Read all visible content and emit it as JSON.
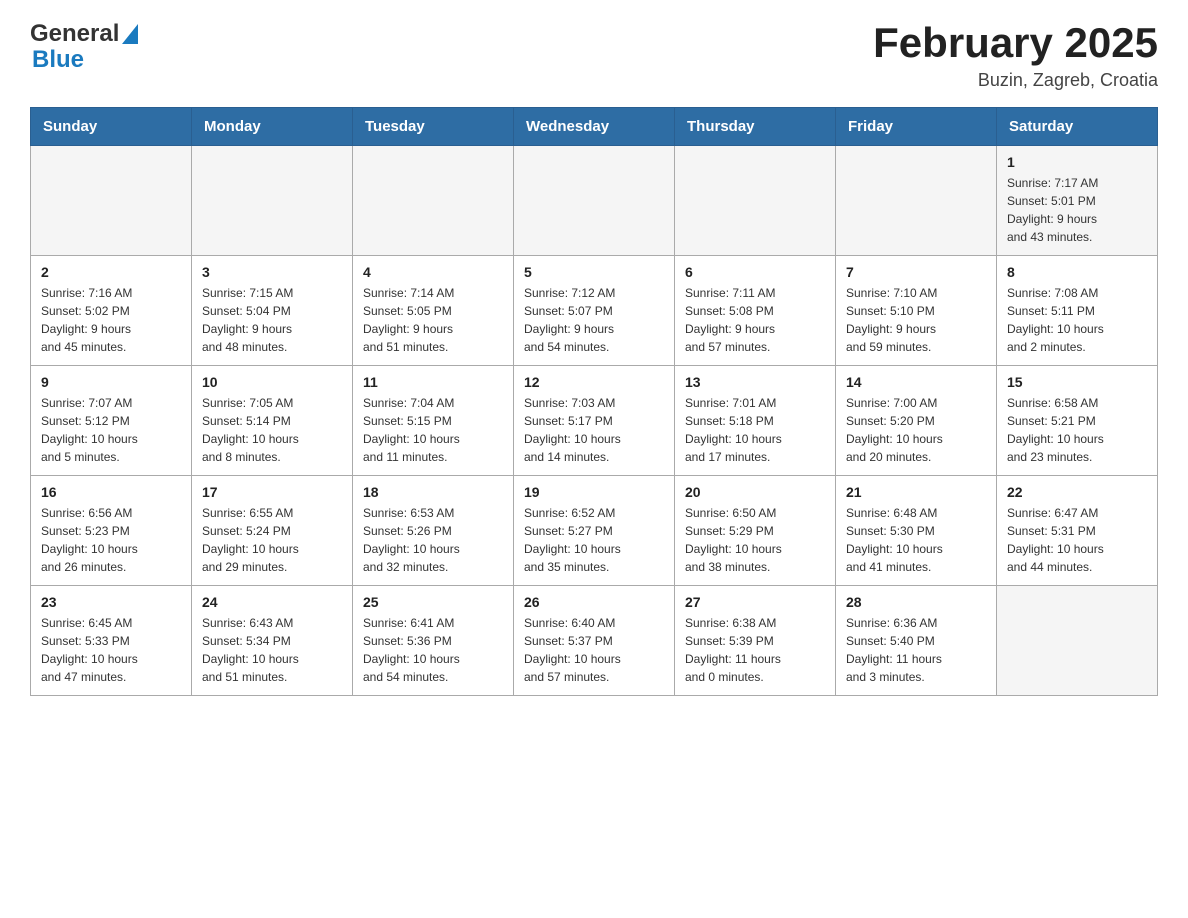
{
  "header": {
    "title": "February 2025",
    "subtitle": "Buzin, Zagreb, Croatia"
  },
  "logo": {
    "general": "General",
    "blue": "Blue"
  },
  "days_of_week": [
    "Sunday",
    "Monday",
    "Tuesday",
    "Wednesday",
    "Thursday",
    "Friday",
    "Saturday"
  ],
  "weeks": [
    {
      "id": "week0",
      "days": [
        {
          "date": "",
          "info": ""
        },
        {
          "date": "",
          "info": ""
        },
        {
          "date": "",
          "info": ""
        },
        {
          "date": "",
          "info": ""
        },
        {
          "date": "",
          "info": ""
        },
        {
          "date": "",
          "info": ""
        },
        {
          "date": "1",
          "info": "Sunrise: 7:17 AM\nSunset: 5:01 PM\nDaylight: 9 hours\nand 43 minutes."
        }
      ]
    },
    {
      "id": "week1",
      "days": [
        {
          "date": "2",
          "info": "Sunrise: 7:16 AM\nSunset: 5:02 PM\nDaylight: 9 hours\nand 45 minutes."
        },
        {
          "date": "3",
          "info": "Sunrise: 7:15 AM\nSunset: 5:04 PM\nDaylight: 9 hours\nand 48 minutes."
        },
        {
          "date": "4",
          "info": "Sunrise: 7:14 AM\nSunset: 5:05 PM\nDaylight: 9 hours\nand 51 minutes."
        },
        {
          "date": "5",
          "info": "Sunrise: 7:12 AM\nSunset: 5:07 PM\nDaylight: 9 hours\nand 54 minutes."
        },
        {
          "date": "6",
          "info": "Sunrise: 7:11 AM\nSunset: 5:08 PM\nDaylight: 9 hours\nand 57 minutes."
        },
        {
          "date": "7",
          "info": "Sunrise: 7:10 AM\nSunset: 5:10 PM\nDaylight: 9 hours\nand 59 minutes."
        },
        {
          "date": "8",
          "info": "Sunrise: 7:08 AM\nSunset: 5:11 PM\nDaylight: 10 hours\nand 2 minutes."
        }
      ]
    },
    {
      "id": "week2",
      "days": [
        {
          "date": "9",
          "info": "Sunrise: 7:07 AM\nSunset: 5:12 PM\nDaylight: 10 hours\nand 5 minutes."
        },
        {
          "date": "10",
          "info": "Sunrise: 7:05 AM\nSunset: 5:14 PM\nDaylight: 10 hours\nand 8 minutes."
        },
        {
          "date": "11",
          "info": "Sunrise: 7:04 AM\nSunset: 5:15 PM\nDaylight: 10 hours\nand 11 minutes."
        },
        {
          "date": "12",
          "info": "Sunrise: 7:03 AM\nSunset: 5:17 PM\nDaylight: 10 hours\nand 14 minutes."
        },
        {
          "date": "13",
          "info": "Sunrise: 7:01 AM\nSunset: 5:18 PM\nDaylight: 10 hours\nand 17 minutes."
        },
        {
          "date": "14",
          "info": "Sunrise: 7:00 AM\nSunset: 5:20 PM\nDaylight: 10 hours\nand 20 minutes."
        },
        {
          "date": "15",
          "info": "Sunrise: 6:58 AM\nSunset: 5:21 PM\nDaylight: 10 hours\nand 23 minutes."
        }
      ]
    },
    {
      "id": "week3",
      "days": [
        {
          "date": "16",
          "info": "Sunrise: 6:56 AM\nSunset: 5:23 PM\nDaylight: 10 hours\nand 26 minutes."
        },
        {
          "date": "17",
          "info": "Sunrise: 6:55 AM\nSunset: 5:24 PM\nDaylight: 10 hours\nand 29 minutes."
        },
        {
          "date": "18",
          "info": "Sunrise: 6:53 AM\nSunset: 5:26 PM\nDaylight: 10 hours\nand 32 minutes."
        },
        {
          "date": "19",
          "info": "Sunrise: 6:52 AM\nSunset: 5:27 PM\nDaylight: 10 hours\nand 35 minutes."
        },
        {
          "date": "20",
          "info": "Sunrise: 6:50 AM\nSunset: 5:29 PM\nDaylight: 10 hours\nand 38 minutes."
        },
        {
          "date": "21",
          "info": "Sunrise: 6:48 AM\nSunset: 5:30 PM\nDaylight: 10 hours\nand 41 minutes."
        },
        {
          "date": "22",
          "info": "Sunrise: 6:47 AM\nSunset: 5:31 PM\nDaylight: 10 hours\nand 44 minutes."
        }
      ]
    },
    {
      "id": "week4",
      "days": [
        {
          "date": "23",
          "info": "Sunrise: 6:45 AM\nSunset: 5:33 PM\nDaylight: 10 hours\nand 47 minutes."
        },
        {
          "date": "24",
          "info": "Sunrise: 6:43 AM\nSunset: 5:34 PM\nDaylight: 10 hours\nand 51 minutes."
        },
        {
          "date": "25",
          "info": "Sunrise: 6:41 AM\nSunset: 5:36 PM\nDaylight: 10 hours\nand 54 minutes."
        },
        {
          "date": "26",
          "info": "Sunrise: 6:40 AM\nSunset: 5:37 PM\nDaylight: 10 hours\nand 57 minutes."
        },
        {
          "date": "27",
          "info": "Sunrise: 6:38 AM\nSunset: 5:39 PM\nDaylight: 11 hours\nand 0 minutes."
        },
        {
          "date": "28",
          "info": "Sunrise: 6:36 AM\nSunset: 5:40 PM\nDaylight: 11 hours\nand 3 minutes."
        },
        {
          "date": "",
          "info": ""
        }
      ]
    }
  ]
}
